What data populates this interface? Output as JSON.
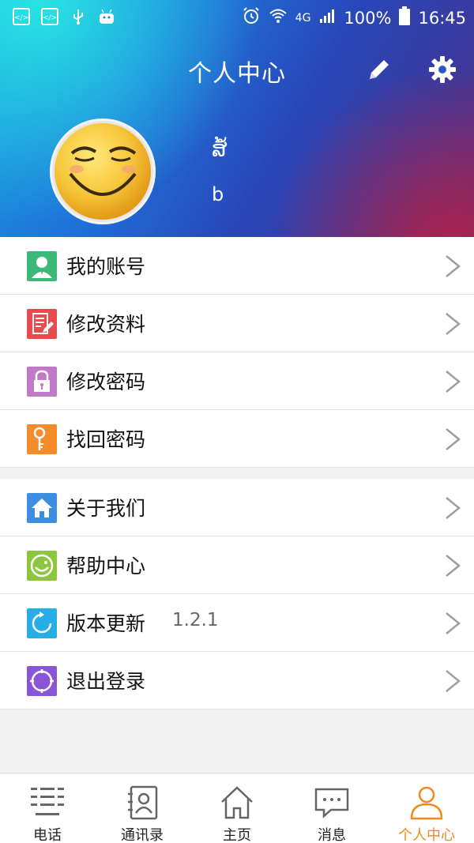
{
  "status_bar": {
    "battery_percent": "100%",
    "time": "16:45",
    "network": "4G"
  },
  "header": {
    "title": "个人中心",
    "edit_icon": "pencil-icon",
    "settings_icon": "gear-icon"
  },
  "profile": {
    "name_line1": "ສໍ້",
    "name_line2": "b"
  },
  "menu_section1": [
    {
      "label": "我的账号",
      "icon": "account-icon",
      "color": "#3cb878"
    },
    {
      "label": "修改资料",
      "icon": "edit-profile-icon",
      "color": "#e84c4c"
    },
    {
      "label": "修改密码",
      "icon": "lock-icon",
      "color": "#c279c8"
    },
    {
      "label": "找回密码",
      "icon": "key-icon",
      "color": "#f58c2a"
    }
  ],
  "menu_section2": [
    {
      "label": "关于我们",
      "icon": "home-icon",
      "color": "#3d8de0"
    },
    {
      "label": "帮助中心",
      "icon": "smile-icon",
      "color": "#8cc63f"
    },
    {
      "label": "版本更新",
      "icon": "refresh-icon",
      "color": "#27aee6",
      "version": "1.2.1"
    },
    {
      "label": "退出登录",
      "icon": "logout-icon",
      "color": "#8a56d8"
    }
  ],
  "bottom_nav": [
    {
      "label": "电话",
      "icon": "dialpad-icon"
    },
    {
      "label": "通讯录",
      "icon": "contacts-icon"
    },
    {
      "label": "主页",
      "icon": "home-outline-icon"
    },
    {
      "label": "消息",
      "icon": "message-icon"
    },
    {
      "label": "个人中心",
      "icon": "person-icon",
      "active": true
    }
  ],
  "colors": {
    "accent": "#f08a1c",
    "chevron": "#9e9e9e"
  }
}
